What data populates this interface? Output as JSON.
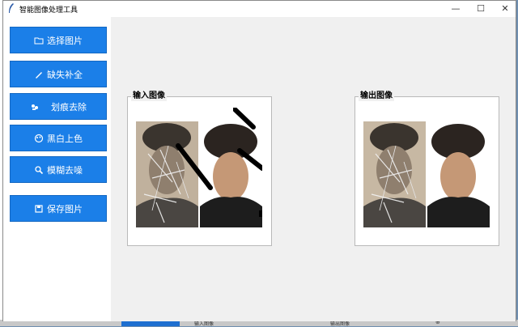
{
  "window": {
    "title": "智能图像处理工具"
  },
  "titlebar_buttons": {
    "minimize": "—",
    "maximize": "☐",
    "close": "✕"
  },
  "sidebar": {
    "buttons": [
      {
        "label": "选择图片",
        "icon": "folder-icon"
      },
      {
        "label": "缺失补全",
        "icon": "pen-icon"
      },
      {
        "label": "划痕去除",
        "icon": "paint-icon"
      },
      {
        "label": "黑白上色",
        "icon": "palette-icon"
      },
      {
        "label": "模糊去噪",
        "icon": "magnifier-icon"
      },
      {
        "label": "保存图片",
        "icon": "save-icon"
      }
    ]
  },
  "panels": {
    "input": {
      "label": "输入图像"
    },
    "output": {
      "label": "输出图像"
    }
  },
  "background": {
    "taskbar_left": "输入图像",
    "taskbar_right": "输出图像"
  },
  "colors": {
    "button": "#1b7fe8",
    "window_bg": "#f0f0f0"
  }
}
